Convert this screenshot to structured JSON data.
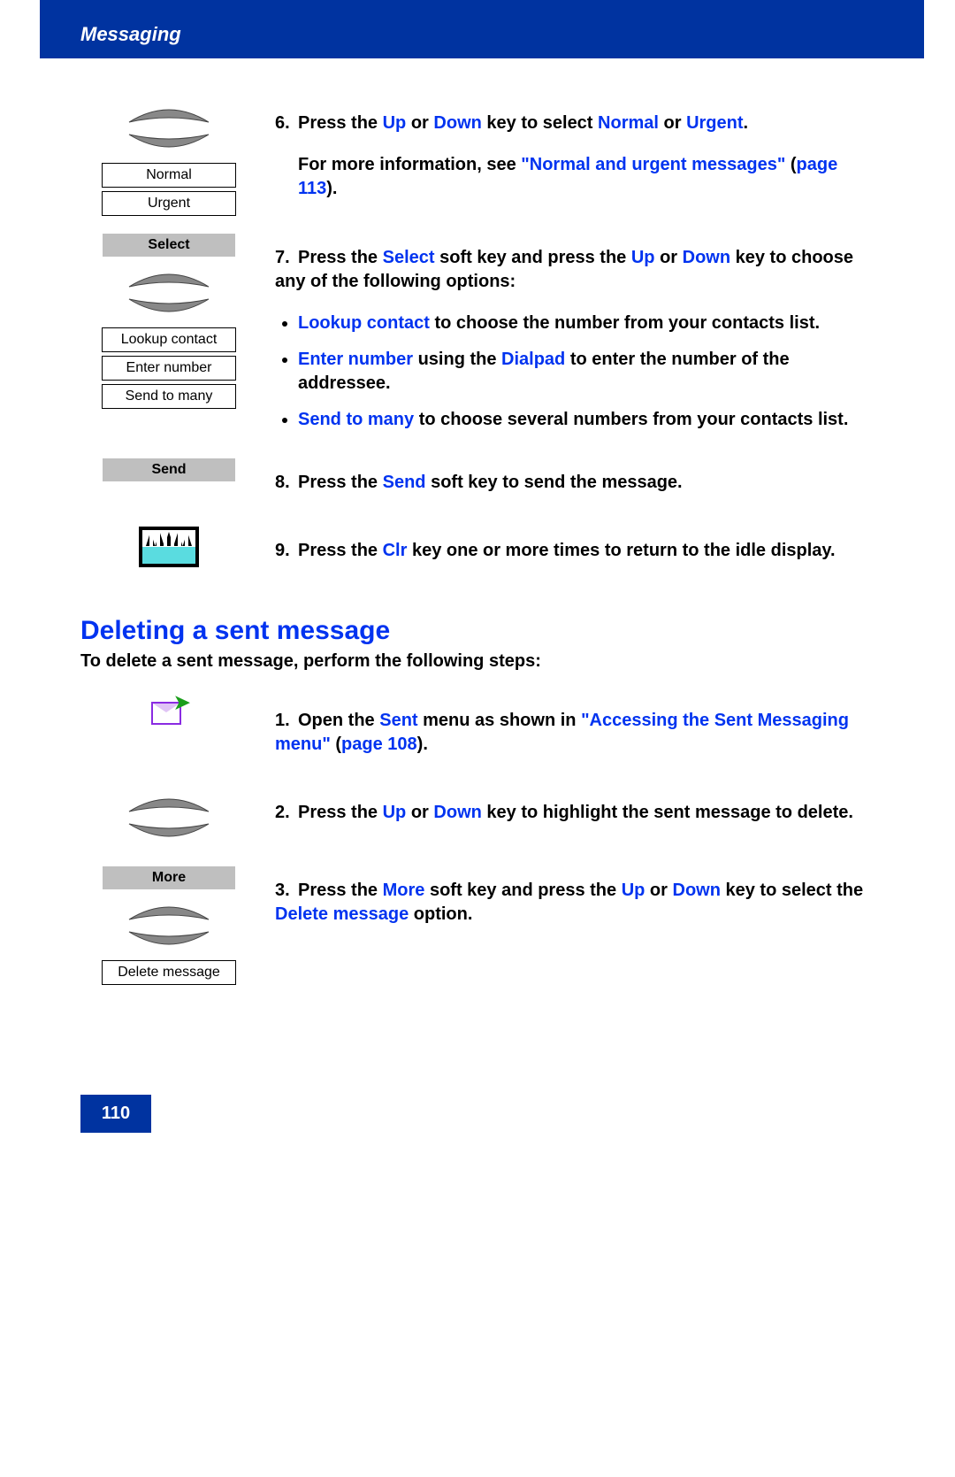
{
  "header": {
    "title": "Messaging"
  },
  "page_number": "110",
  "step6": {
    "num": "6.",
    "t1": "Press the ",
    "up": "Up",
    "t2": " or ",
    "down": "Down",
    "t3": " key to select ",
    "normal": "Normal",
    "t4": " or ",
    "urgent": "Urgent",
    "t5": ".",
    "more1": "For more information, see ",
    "link": "\"Normal and urgent messages\"",
    "more2": " (",
    "pagelink": "page 113",
    "more3": ").",
    "opt_normal": "Normal",
    "opt_urgent": "Urgent"
  },
  "step7": {
    "num": "7.",
    "softkey": "Select",
    "opt1": "Lookup contact",
    "opt2": "Enter number",
    "opt3": "Send to many",
    "t1": "Press the ",
    "select": "Select",
    "t2": " soft key and press the ",
    "up": "Up",
    "t3": " or ",
    "down": "Down",
    "t4": " key to choose any of the following options:",
    "b1a": "Lookup contact",
    "b1b": " to choose the number from your contacts list.",
    "b2a": "Enter number",
    "b2b": " using the ",
    "b2c": "Dialpad",
    "b2d": " to enter the number of the addressee.",
    "b3a": "Send to many",
    "b3b": " to choose several numbers from your contacts list."
  },
  "step8": {
    "num": "8.",
    "softkey": "Send",
    "t1": "Press the ",
    "send": "Send",
    "t2": " soft key to send the message."
  },
  "step9": {
    "num": "9.",
    "t1": "Press the ",
    "clr": "Clr",
    "t2": " key one or more times to return to the idle display."
  },
  "section_title": "Deleting a sent message",
  "intro": "To delete a sent message, perform the following steps:",
  "d1": {
    "num": "1.",
    "t1": "Open the ",
    "sent": "Sent",
    "t2": " menu as shown in ",
    "link": "\"Accessing the Sent Messaging menu\"",
    "t3": " (",
    "pagelink": "page 108",
    "t4": ")."
  },
  "d2": {
    "num": "2.",
    "t1": "Press the ",
    "up": "Up",
    "t2": " or ",
    "down": "Down",
    "t3": " key to highlight the sent message to delete."
  },
  "d3": {
    "num": "3.",
    "softkey": "More",
    "opt": "Delete message",
    "t1": "Press the ",
    "more": "More",
    "t2": " soft key and press the ",
    "up": "Up",
    "t3": " or ",
    "down": "Down",
    "t4": " key to select the ",
    "del": "Delete message",
    "t5": " option."
  }
}
